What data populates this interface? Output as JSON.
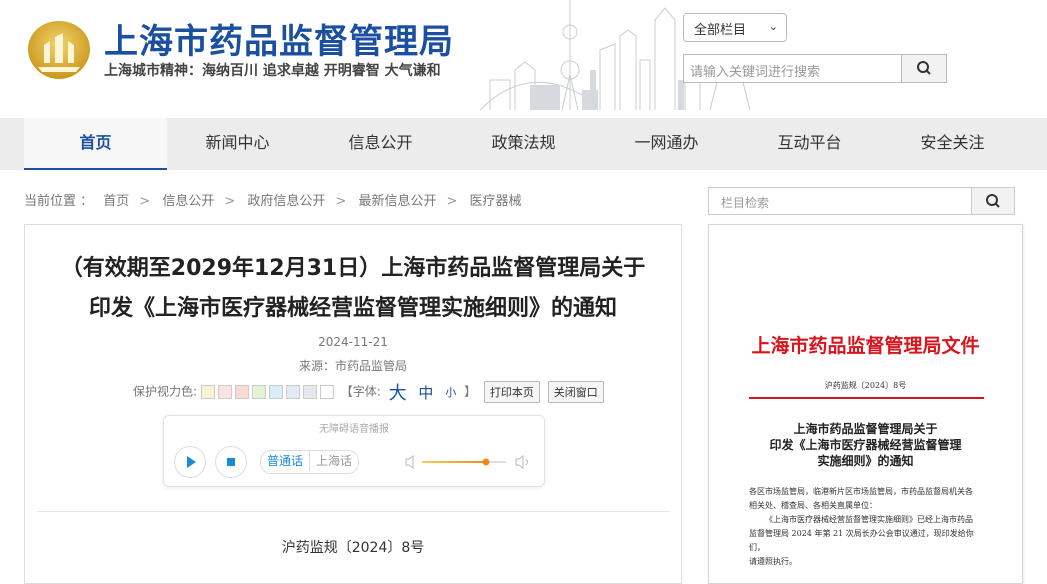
{
  "header": {
    "title": "上海市药品监督管理局",
    "motto": "上海城市精神：海纳百川  追求卓越  开明睿智  大气谦和",
    "category_select": "全部栏目",
    "search_placeholder": "请输入关键词进行搜索"
  },
  "nav": {
    "items": [
      "首页",
      "新闻中心",
      "信息公开",
      "政策法规",
      "一网通办",
      "互动平台",
      "安全关注"
    ],
    "active_index": 0
  },
  "breadcrumb": {
    "label": "当前位置 ：",
    "items": [
      "首页",
      "信息公开",
      "政府信息公开",
      "最新信息公开",
      "医疗器械"
    ]
  },
  "article": {
    "title_line1": "（有效期至2029年12月31日）上海市药品监督管理局关于",
    "title_line2": "印发《上海市医疗器械经营监督管理实施细则》的通知",
    "date": "2024-11-21",
    "source": "来源：市药品监管局",
    "eye_color_label": "保护视力色:",
    "font_label": "【字体:",
    "font_large": "大",
    "font_medium": "中",
    "font_small": "小",
    "font_close": "】",
    "print_button": "打印本页",
    "close_button": "关闭窗口",
    "player_label": "无障碍语音播报",
    "lang_mandarin": "普通话",
    "lang_shanghai": "上海话",
    "doc_number": "沪药监规〔2024〕8号"
  },
  "sidebar": {
    "search_placeholder": "栏目检索"
  },
  "document_preview": {
    "header": "上海市药品监督管理局文件",
    "number": "沪药监规〔2024〕8号",
    "subject_line1": "上海市药品监督管理局关于",
    "subject_line2": "印发《上海市医疗器械经营监督管理",
    "subject_line3": "实施细则》的通知",
    "body_line1": "各区市场监管局，临港新片区市场监管局，市药品监督局机关各",
    "body_line2": "相关处、稽查局、各相关直属单位：",
    "body_line3": "《上海市医疗器械经营监督管理实施细则》已经上海市药品",
    "body_line4": "监督管理局 2024 年第 21 次局长办公会审议通过，现印发给你们，",
    "body_line5": "请遵照执行。"
  },
  "colors": {
    "brand_blue": "#1b4fa0",
    "doc_red": "#d8141c",
    "nav_bg": "#ececec",
    "swatches": [
      "#f7f3d4",
      "#fbe3e0",
      "#fbd9d5",
      "#e4f2d8",
      "#d9eef7",
      "#e2eaf4",
      "#e6e6ef",
      "#ffffff"
    ]
  }
}
